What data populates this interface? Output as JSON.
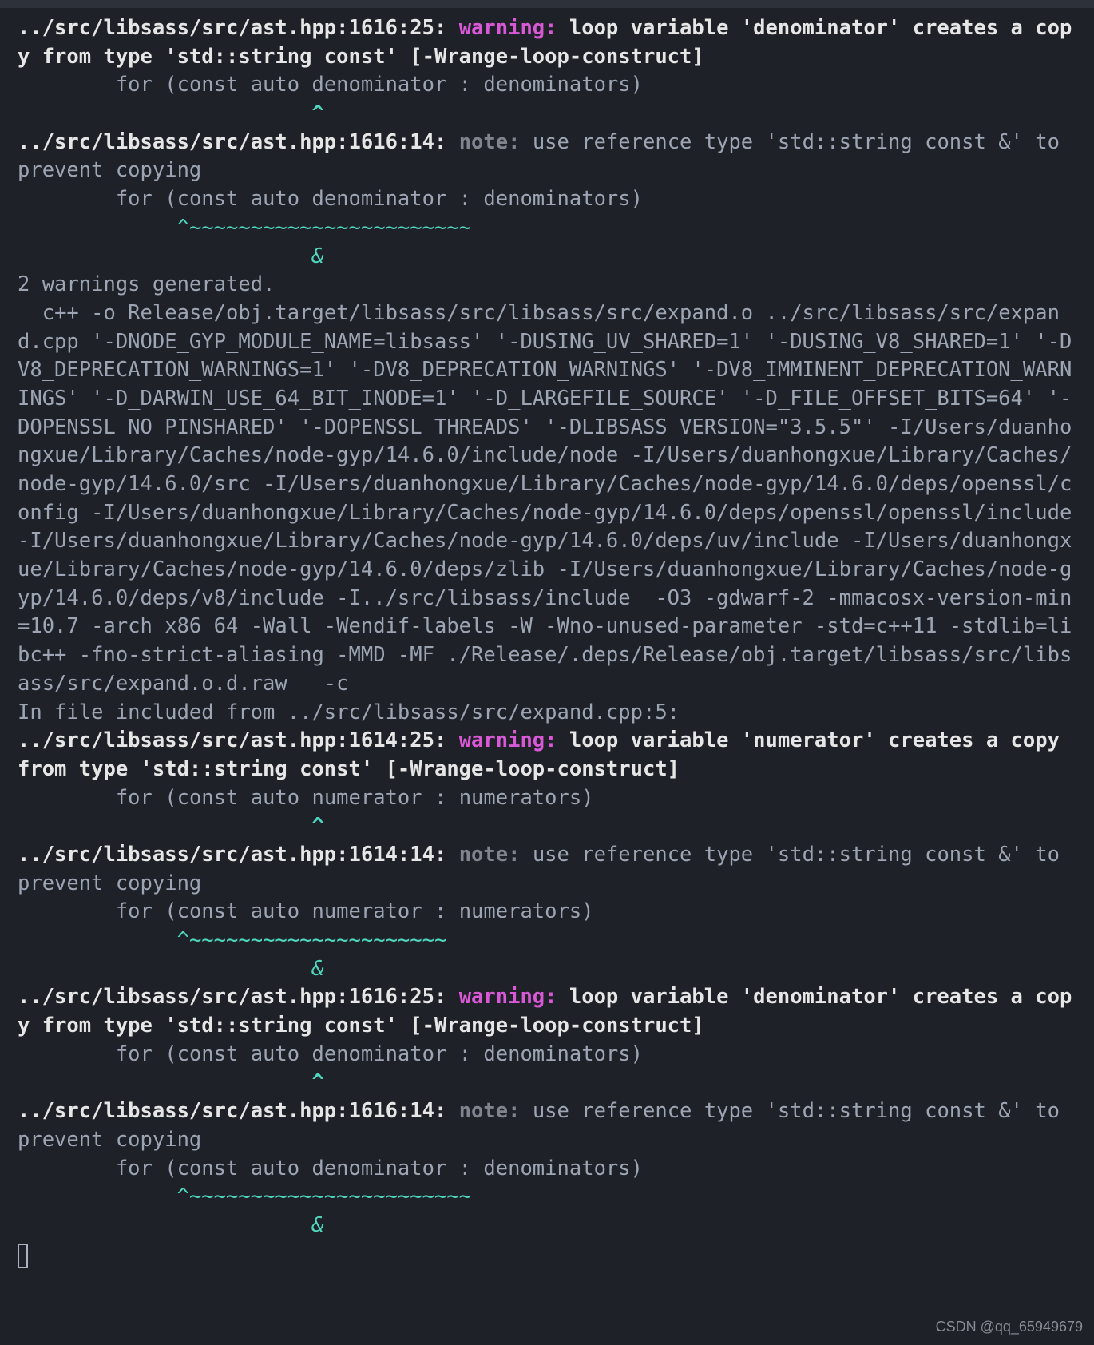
{
  "blocks": [
    {
      "segments": [
        {
          "cls": "bold",
          "text": "../src/libsass/src/ast.hpp:1616:25: "
        },
        {
          "cls": "warning",
          "text": "warning: "
        },
        {
          "cls": "bold",
          "text": "loop variable 'denominator' creates a copy from type 'std::string const' [-Wrange-loop-construct]"
        }
      ]
    },
    {
      "segments": [
        {
          "cls": "dim",
          "text": "        for (const auto denominator : denominators)"
        }
      ]
    },
    {
      "segments": [
        {
          "cls": "caret",
          "text": "                        ^"
        }
      ]
    },
    {
      "segments": [
        {
          "cls": "bold",
          "text": "../src/libsass/src/ast.hpp:1616:14: "
        },
        {
          "cls": "note",
          "text": "note: "
        },
        {
          "cls": "dim",
          "text": "use reference type 'std::string const &' to prevent copying"
        }
      ]
    },
    {
      "segments": [
        {
          "cls": "dim",
          "text": "        for (const auto denominator : denominators)"
        }
      ]
    },
    {
      "segments": [
        {
          "cls": "squiggle",
          "text": "             ^~~~~~~~~~~~~~~~~~~~~~~~"
        }
      ]
    },
    {
      "segments": [
        {
          "cls": "amp",
          "text": "                        &"
        }
      ]
    },
    {
      "segments": [
        {
          "cls": "dim",
          "text": "2 warnings generated."
        }
      ]
    },
    {
      "segments": [
        {
          "cls": "dim",
          "text": "  c++ -o Release/obj.target/libsass/src/libsass/src/expand.o ../src/libsass/src/expand.cpp '-DNODE_GYP_MODULE_NAME=libsass' '-DUSING_UV_SHARED=1' '-DUSING_V8_SHARED=1' '-DV8_DEPRECATION_WARNINGS=1' '-DV8_DEPRECATION_WARNINGS' '-DV8_IMMINENT_DEPRECATION_WARNINGS' '-D_DARWIN_USE_64_BIT_INODE=1' '-D_LARGEFILE_SOURCE' '-D_FILE_OFFSET_BITS=64' '-DOPENSSL_NO_PINSHARED' '-DOPENSSL_THREADS' '-DLIBSASS_VERSION=\"3.5.5\"' -I/Users/duanhongxue/Library/Caches/node-gyp/14.6.0/include/node -I/Users/duanhongxue/Library/Caches/node-gyp/14.6.0/src -I/Users/duanhongxue/Library/Caches/node-gyp/14.6.0/deps/openssl/config -I/Users/duanhongxue/Library/Caches/node-gyp/14.6.0/deps/openssl/openssl/include -I/Users/duanhongxue/Library/Caches/node-gyp/14.6.0/deps/uv/include -I/Users/duanhongxue/Library/Caches/node-gyp/14.6.0/deps/zlib -I/Users/duanhongxue/Library/Caches/node-gyp/14.6.0/deps/v8/include -I../src/libsass/include  -O3 -gdwarf-2 -mmacosx-version-min=10.7 -arch x86_64 -Wall -Wendif-labels -W -Wno-unused-parameter -std=c++11 -stdlib=libc++ -fno-strict-aliasing -MMD -MF ./Release/.deps/Release/obj.target/libsass/src/libsass/src/expand.o.d.raw   -c"
        }
      ]
    },
    {
      "segments": [
        {
          "cls": "dim",
          "text": "In file included from ../src/libsass/src/expand.cpp:5:"
        }
      ]
    },
    {
      "segments": [
        {
          "cls": "bold",
          "text": "../src/libsass/src/ast.hpp:1614:25: "
        },
        {
          "cls": "warning",
          "text": "warning: "
        },
        {
          "cls": "bold",
          "text": "loop variable 'numerator' creates a copy from type 'std::string const' [-Wrange-loop-construct]"
        }
      ]
    },
    {
      "segments": [
        {
          "cls": "dim",
          "text": "        for (const auto numerator : numerators)"
        }
      ]
    },
    {
      "segments": [
        {
          "cls": "caret",
          "text": "                        ^"
        }
      ]
    },
    {
      "segments": [
        {
          "cls": "bold",
          "text": "../src/libsass/src/ast.hpp:1614:14: "
        },
        {
          "cls": "note",
          "text": "note: "
        },
        {
          "cls": "dim",
          "text": "use reference type 'std::string const &' to prevent copying"
        }
      ]
    },
    {
      "segments": [
        {
          "cls": "dim",
          "text": "        for (const auto numerator : numerators)"
        }
      ]
    },
    {
      "segments": [
        {
          "cls": "squiggle",
          "text": "             ^~~~~~~~~~~~~~~~~~~~~~"
        }
      ]
    },
    {
      "segments": [
        {
          "cls": "amp",
          "text": "                        &"
        }
      ]
    },
    {
      "segments": [
        {
          "cls": "bold",
          "text": "../src/libsass/src/ast.hpp:1616:25: "
        },
        {
          "cls": "warning",
          "text": "warning: "
        },
        {
          "cls": "bold",
          "text": "loop variable 'denominator' creates a copy from type 'std::string const' [-Wrange-loop-construct]"
        }
      ]
    },
    {
      "segments": [
        {
          "cls": "dim",
          "text": "        for (const auto denominator : denominators)"
        }
      ]
    },
    {
      "segments": [
        {
          "cls": "caret",
          "text": "                        ^"
        }
      ]
    },
    {
      "segments": [
        {
          "cls": "bold",
          "text": "../src/libsass/src/ast.hpp:1616:14: "
        },
        {
          "cls": "note",
          "text": "note: "
        },
        {
          "cls": "dim",
          "text": "use reference type 'std::string const &' to prevent copying"
        }
      ]
    },
    {
      "segments": [
        {
          "cls": "dim",
          "text": "        for (const auto denominator : denominators)"
        }
      ]
    },
    {
      "segments": [
        {
          "cls": "squiggle",
          "text": "             ^~~~~~~~~~~~~~~~~~~~~~~~"
        }
      ]
    },
    {
      "segments": [
        {
          "cls": "amp",
          "text": "                        &"
        }
      ]
    }
  ],
  "watermark": "CSDN @qq_65949679"
}
